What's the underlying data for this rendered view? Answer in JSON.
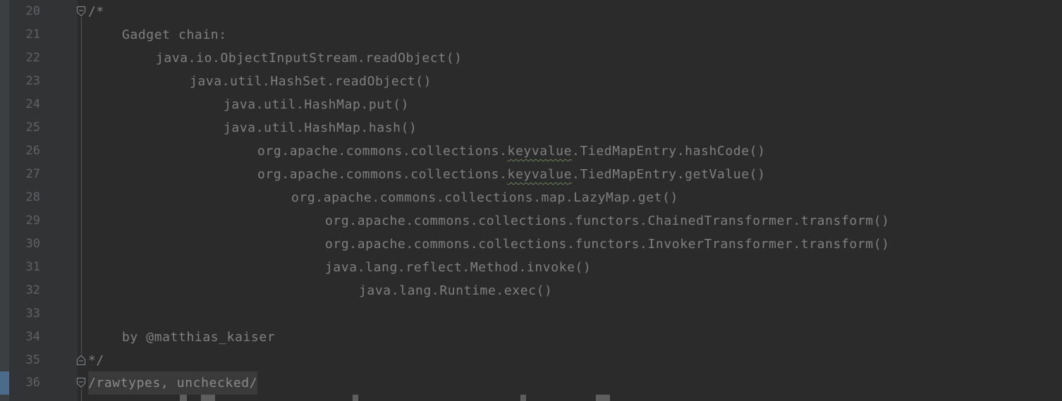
{
  "editor": {
    "lines": [
      {
        "num": "20",
        "text": "/*"
      },
      {
        "num": "21",
        "text": "Gadget chain:"
      },
      {
        "num": "22",
        "text": "java.io.ObjectInputStream.readObject()"
      },
      {
        "num": "23",
        "text": "java.util.HashSet.readObject()"
      },
      {
        "num": "24",
        "text": "java.util.HashMap.put()"
      },
      {
        "num": "25",
        "text": "java.util.HashMap.hash()"
      },
      {
        "num": "26",
        "pre": "org.apache.commons.collections.",
        "mid": "keyvalue",
        "post": ".TiedMapEntry.hashCode()"
      },
      {
        "num": "27",
        "pre": "org.apache.commons.collections.",
        "mid": "keyvalue",
        "post": ".TiedMapEntry.getValue()"
      },
      {
        "num": "28",
        "text": "org.apache.commons.collections.map.LazyMap.get()"
      },
      {
        "num": "29",
        "text": "org.apache.commons.collections.functors.ChainedTransformer.transform()"
      },
      {
        "num": "30",
        "text": "org.apache.commons.collections.functors.InvokerTransformer.transform()"
      },
      {
        "num": "31",
        "text": "java.lang.reflect.Method.invoke()"
      },
      {
        "num": "32",
        "text": "java.lang.Runtime.exec()"
      },
      {
        "num": "33",
        "text": ""
      },
      {
        "num": "34",
        "text": "by @matthias_kaiser"
      },
      {
        "num": "35",
        "text": "*/"
      },
      {
        "num": "36",
        "text": "/rawtypes, unchecked/"
      }
    ]
  },
  "colors": {
    "background": "#2b2b2b",
    "gutter": "#313335",
    "line_number": "#606366",
    "comment_text": "#808080",
    "typo_underline": "#6a8759"
  },
  "icons": {
    "fold_open": "fold-open-icon",
    "fold_close": "fold-close-icon"
  }
}
